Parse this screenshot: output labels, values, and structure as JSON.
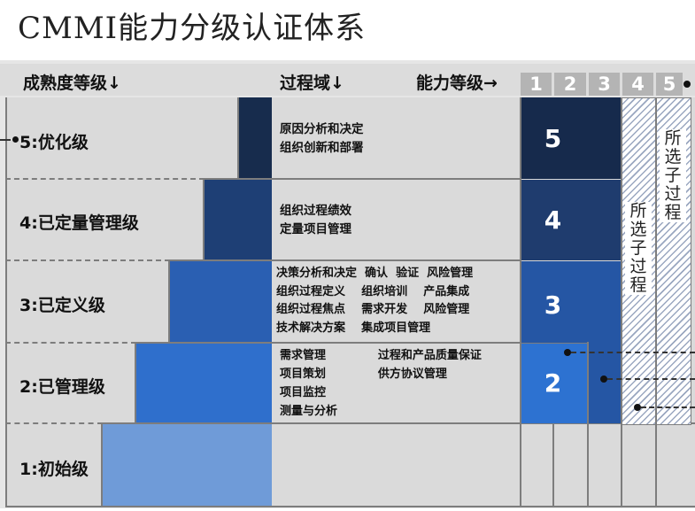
{
  "title": "CMMI能力分级认证体系",
  "header": {
    "maturity_label": "成熟度等级↓",
    "process_area_label": "过程域↓",
    "capability_label": "能力等级→",
    "capability_levels": [
      "1",
      "2",
      "3",
      "4",
      "5"
    ]
  },
  "rows": [
    {
      "label": "5:优化级",
      "process_areas": "原因分析和决定\n组织创新和部署",
      "capability": "5"
    },
    {
      "label": "4:已定量管理级",
      "process_areas": "组织过程绩效\n定量项目管理",
      "capability": "4"
    },
    {
      "label": "3:已定义级",
      "process_areas": "决策分析和决定  确认  验证  风险管理\n组织过程定义    组织培训    产品集成\n组织过程焦点    需求开发    风险管理\n技术解决方案    集成项目管理",
      "capability": "3"
    },
    {
      "label": "2:已管理级",
      "process_areas": "需求管理             过程和产品质量保证\n项目策划             供方协议管理\n项目监控\n测量与分析",
      "capability": "2"
    },
    {
      "label": "1:初始级",
      "process_areas": "",
      "capability": ""
    }
  ],
  "selected_processes": {
    "level4": [
      "所",
      "选",
      "子",
      "过",
      "程"
    ],
    "level5": [
      "所",
      "选",
      "子",
      "过",
      "程"
    ]
  },
  "colors": {
    "frame": "#7d7d7d",
    "row_bg": "#d9d9d9",
    "level1_bar": "#6f9bd8",
    "level2_bar": "#2f6fcc",
    "level3_bar": "#2a5fb2",
    "level4_bar": "#1e3f75",
    "level5_bar": "#172c4d",
    "cap5": "#162a4c",
    "cap4": "#1f3c6e",
    "cap3": "#2556a4",
    "cap2": "#2d72d1"
  }
}
